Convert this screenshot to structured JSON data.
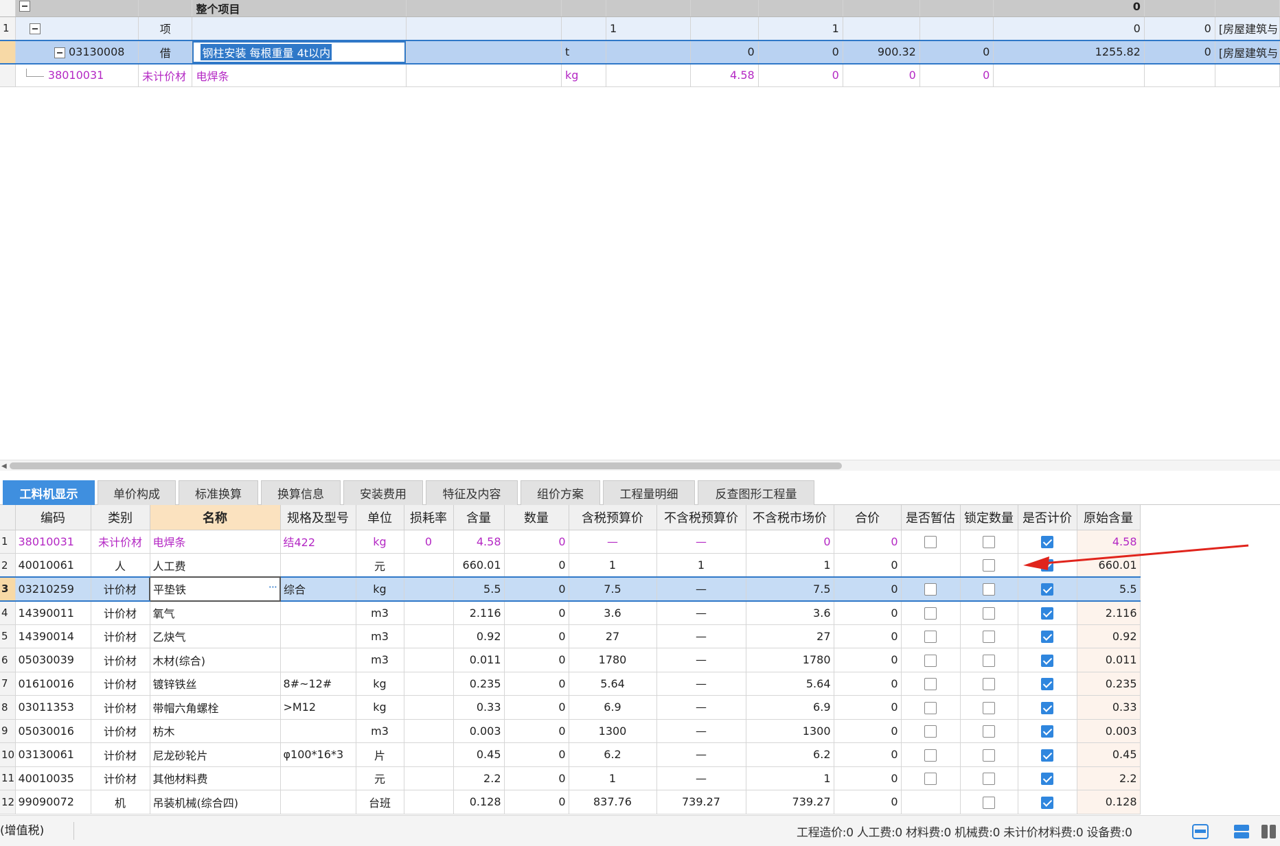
{
  "top_grid": {
    "root_label": "整个项目",
    "root_value": "0",
    "rows": [
      {
        "idx": "1",
        "code": "",
        "type": "项",
        "name": "",
        "spec": "",
        "unit": "",
        "c1": "1",
        "c2": "",
        "c3": "1",
        "c4": "",
        "c5": "",
        "c6": "0",
        "c7": "0",
        "tail": "[房屋建筑与"
      },
      {
        "idx": "",
        "code": "03130008",
        "type": "借",
        "name": "钢柱安装 每根重量 4t以内",
        "spec": "",
        "unit": "t",
        "c1": "",
        "c2": "0",
        "c3": "0",
        "c4": "900.32",
        "c5": "0",
        "c6": "1255.82",
        "c7": "0",
        "tail": "[房屋建筑与"
      },
      {
        "idx": "",
        "code": "38010031",
        "type": "未计价材",
        "name": "电焊条",
        "spec": "",
        "unit": "kg",
        "c1": "",
        "c2": "4.58",
        "c3": "0",
        "c4": "0",
        "c5": "0",
        "c6": "",
        "c7": "",
        "tail": ""
      }
    ]
  },
  "tabs": [
    "工料机显示",
    "单价构成",
    "标准换算",
    "换算信息",
    "安装费用",
    "特征及内容",
    "组价方案",
    "工程量明细",
    "反查图形工程量"
  ],
  "active_tab": 0,
  "grid": {
    "headers": [
      "编码",
      "类别",
      "名称",
      "规格及型号",
      "单位",
      "损耗率",
      "含量",
      "数量",
      "含税预算价",
      "不含税预算价",
      "不含税市场价",
      "合价",
      "是否暂估",
      "锁定数量",
      "是否计价",
      "原始含量"
    ],
    "rows": [
      {
        "idx": "1",
        "code": "38010031",
        "type": "未计价材",
        "name": "电焊条",
        "spec": "结422",
        "unit": "kg",
        "loss": "0",
        "content": "4.58",
        "qty": "0",
        "tax_price": "—",
        "notax_price": "—",
        "market": "0",
        "total": "0",
        "est": "off",
        "lock": "off",
        "priced": "on",
        "orig": "4.58"
      },
      {
        "idx": "2",
        "code": "40010061",
        "type": "人",
        "name": "人工费",
        "spec": "",
        "unit": "元",
        "loss": "",
        "content": "660.01",
        "qty": "0",
        "tax_price": "1",
        "notax_price": "1",
        "market": "1",
        "total": "0",
        "est": "none",
        "lock": "off",
        "priced": "on",
        "orig": "660.01"
      },
      {
        "idx": "3",
        "code": "03210259",
        "type": "计价材",
        "name": "平垫铁",
        "spec": "综合",
        "unit": "kg",
        "loss": "",
        "content": "5.5",
        "qty": "0",
        "tax_price": "7.5",
        "notax_price": "—",
        "market": "7.5",
        "total": "0",
        "est": "off",
        "lock": "off",
        "priced": "on",
        "orig": "5.5"
      },
      {
        "idx": "4",
        "code": "14390011",
        "type": "计价材",
        "name": "氧气",
        "spec": "",
        "unit": "m3",
        "loss": "",
        "content": "2.116",
        "qty": "0",
        "tax_price": "3.6",
        "notax_price": "—",
        "market": "3.6",
        "total": "0",
        "est": "off",
        "lock": "off",
        "priced": "on",
        "orig": "2.116"
      },
      {
        "idx": "5",
        "code": "14390014",
        "type": "计价材",
        "name": "乙炔气",
        "spec": "",
        "unit": "m3",
        "loss": "",
        "content": "0.92",
        "qty": "0",
        "tax_price": "27",
        "notax_price": "—",
        "market": "27",
        "total": "0",
        "est": "off",
        "lock": "off",
        "priced": "on",
        "orig": "0.92"
      },
      {
        "idx": "6",
        "code": "05030039",
        "type": "计价材",
        "name": "木材(综合)",
        "spec": "",
        "unit": "m3",
        "loss": "",
        "content": "0.011",
        "qty": "0",
        "tax_price": "1780",
        "notax_price": "—",
        "market": "1780",
        "total": "0",
        "est": "off",
        "lock": "off",
        "priced": "on",
        "orig": "0.011"
      },
      {
        "idx": "7",
        "code": "01610016",
        "type": "计价材",
        "name": "镀锌铁丝",
        "spec": "8#~12#",
        "unit": "kg",
        "loss": "",
        "content": "0.235",
        "qty": "0",
        "tax_price": "5.64",
        "notax_price": "—",
        "market": "5.64",
        "total": "0",
        "est": "off",
        "lock": "off",
        "priced": "on",
        "orig": "0.235"
      },
      {
        "idx": "8",
        "code": "03011353",
        "type": "计价材",
        "name": "带帽六角螺栓",
        "spec": ">M12",
        "unit": "kg",
        "loss": "",
        "content": "0.33",
        "qty": "0",
        "tax_price": "6.9",
        "notax_price": "—",
        "market": "6.9",
        "total": "0",
        "est": "off",
        "lock": "off",
        "priced": "on",
        "orig": "0.33"
      },
      {
        "idx": "9",
        "code": "05030016",
        "type": "计价材",
        "name": "枋木",
        "spec": "",
        "unit": "m3",
        "loss": "",
        "content": "0.003",
        "qty": "0",
        "tax_price": "1300",
        "notax_price": "—",
        "market": "1300",
        "total": "0",
        "est": "off",
        "lock": "off",
        "priced": "on",
        "orig": "0.003"
      },
      {
        "idx": "10",
        "code": "03130061",
        "type": "计价材",
        "name": "尼龙砂轮片",
        "spec": "φ100*16*3",
        "unit": "片",
        "loss": "",
        "content": "0.45",
        "qty": "0",
        "tax_price": "6.2",
        "notax_price": "—",
        "market": "6.2",
        "total": "0",
        "est": "off",
        "lock": "off",
        "priced": "on",
        "orig": "0.45"
      },
      {
        "idx": "11",
        "code": "40010035",
        "type": "计价材",
        "name": "其他材料费",
        "spec": "",
        "unit": "元",
        "loss": "",
        "content": "2.2",
        "qty": "0",
        "tax_price": "1",
        "notax_price": "—",
        "market": "1",
        "total": "0",
        "est": "off",
        "lock": "off",
        "priced": "on",
        "orig": "2.2"
      },
      {
        "idx": "12",
        "code": "99090072",
        "type": "机",
        "name": "吊装机械(综合四)",
        "spec": "",
        "unit": "台班",
        "loss": "",
        "content": "0.128",
        "qty": "0",
        "tax_price": "837.76",
        "notax_price": "739.27",
        "market": "739.27",
        "total": "0",
        "est": "none",
        "lock": "off",
        "priced": "on",
        "orig": "0.128"
      }
    ]
  },
  "status": {
    "left": "(增值税)",
    "summary": "工程造价:0  人工费:0  材料费:0  机械费:0  未计价材料费:0  设备费:0"
  },
  "colors": {
    "accent": "#2f86de",
    "unpriced_text": "#b428c4",
    "arrow": "#e0241c"
  }
}
